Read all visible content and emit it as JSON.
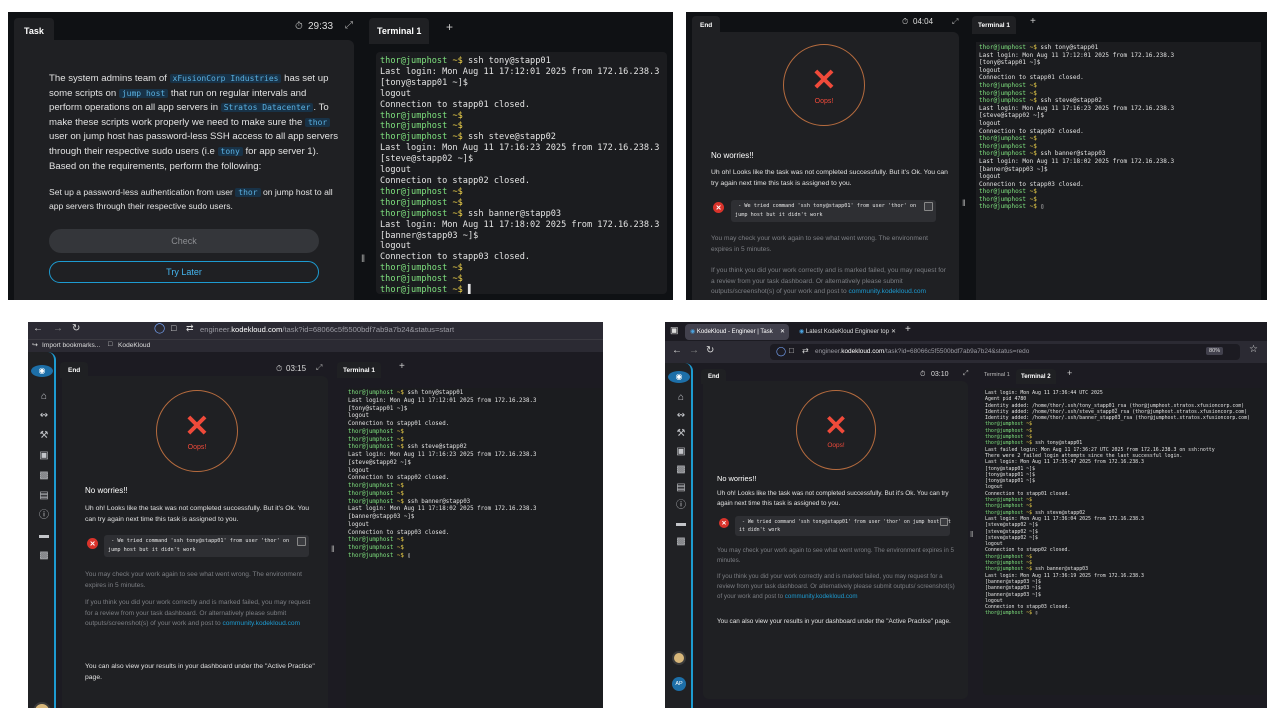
{
  "shot1": {
    "task_tab": "Task",
    "timer": "29:33",
    "term_tab": "Terminal 1",
    "add_tab": "+",
    "paragraph": {
      "p1": "The system admins team of",
      "company": "xFusionCorp Industries",
      "p2": "has set up some scripts on",
      "jumphost": "jump host",
      "p3": "that run on regular intervals and perform operations on all app servers in",
      "dc": "Stratos Datacenter",
      "p4": ". To make these scripts work properly we need to make sure the",
      "thor": "thor",
      "p5": "user on jump host has password-less SSH access to all app servers through their respective sudo users (i.e",
      "tony": "tony",
      "p6": "for app server 1). Based on the requirements, perform the following:"
    },
    "instruction": {
      "p1": "Set up a password-less authentication from user",
      "thor": "thor",
      "p2": "on jump host to all app servers through their respective sudo users."
    },
    "check_label": "Check",
    "try_later_label": "Try Later",
    "terminal": [
      {
        "p": "thor@jumphost",
        "s": " ~$",
        "t": " ssh tony@stapp01"
      },
      {
        "t": "Last login: Mon Aug 11 17:12:01 2025 from 172.16.238.3"
      },
      {
        "t": "[tony@stapp01 ~]$"
      },
      {
        "t": "logout"
      },
      {
        "t": "Connection to stapp01 closed."
      },
      {
        "p": "thor@jumphost",
        "s": " ~$",
        "t": ""
      },
      {
        "p": "thor@jumphost",
        "s": " ~$",
        "t": ""
      },
      {
        "p": "thor@jumphost",
        "s": " ~$",
        "t": " ssh steve@stapp02"
      },
      {
        "t": "Last login: Mon Aug 11 17:16:23 2025 from 172.16.238.3"
      },
      {
        "t": "[steve@stapp02 ~]$"
      },
      {
        "t": "logout"
      },
      {
        "t": "Connection to stapp02 closed."
      },
      {
        "p": "thor@jumphost",
        "s": " ~$",
        "t": ""
      },
      {
        "p": "thor@jumphost",
        "s": " ~$",
        "t": ""
      },
      {
        "p": "thor@jumphost",
        "s": " ~$",
        "t": " ssh banner@stapp03"
      },
      {
        "t": "Last login: Mon Aug 11 17:18:02 2025 from 172.16.238.3"
      },
      {
        "t": "[banner@stapp03 ~]$"
      },
      {
        "t": "logout"
      },
      {
        "t": "Connection to stapp03 closed."
      },
      {
        "p": "thor@jumphost",
        "s": " ~$",
        "t": ""
      },
      {
        "p": "thor@jumphost",
        "s": " ~$",
        "t": ""
      },
      {
        "p": "thor@jumphost",
        "s": " ~$",
        "t": " ▌"
      }
    ]
  },
  "shot2": {
    "end_tab": "End",
    "timer": "04:04",
    "term_tab": "Terminal 1",
    "add_tab": "+",
    "oops": "Oops!",
    "no_worries": "No worries!!",
    "msg": "Uh oh! Looks like the task was not completed successfully. But it's Ok. You can try again next time this task is assigned to you.",
    "err": " - We tried command 'ssh tony@stapp01' from user 'thor' on\njump host but it didn't work",
    "check_again": "You may check your work again to see what went wrong. The environment expires in 5 minutes.",
    "review": "If you think you did your work correctly and is marked failed, you may request for a review from your task dashboard. Or alternatively please submit outputs/screenshot(s) of your work and post to",
    "community": "community.kodekloud.com",
    "terminal": [
      {
        "p": "thor@jumphost",
        "s": " ~$",
        "t": " ssh tony@stapp01"
      },
      {
        "t": "Last login: Mon Aug 11 17:12:01 2025 from 172.16.238.3"
      },
      {
        "t": "[tony@stapp01 ~]$"
      },
      {
        "t": "logout"
      },
      {
        "t": "Connection to stapp01 closed."
      },
      {
        "p": "thor@jumphost",
        "s": " ~$",
        "t": ""
      },
      {
        "p": "thor@jumphost",
        "s": " ~$",
        "t": ""
      },
      {
        "p": "thor@jumphost",
        "s": " ~$",
        "t": " ssh steve@stapp02"
      },
      {
        "t": "Last login: Mon Aug 11 17:16:23 2025 from 172.16.238.3"
      },
      {
        "t": "[steve@stapp02 ~]$"
      },
      {
        "t": "logout"
      },
      {
        "t": "Connection to stapp02 closed."
      },
      {
        "p": "thor@jumphost",
        "s": " ~$",
        "t": ""
      },
      {
        "p": "thor@jumphost",
        "s": " ~$",
        "t": ""
      },
      {
        "p": "thor@jumphost",
        "s": " ~$",
        "t": " ssh banner@stapp03"
      },
      {
        "t": "Last login: Mon Aug 11 17:18:02 2025 from 172.16.238.3"
      },
      {
        "t": "[banner@stapp03 ~]$"
      },
      {
        "t": "logout"
      },
      {
        "t": "Connection to stapp03 closed."
      },
      {
        "p": "thor@jumphost",
        "s": " ~$",
        "t": ""
      },
      {
        "p": "thor@jumphost",
        "s": " ~$",
        "t": ""
      },
      {
        "p": "thor@jumphost",
        "s": " ~$",
        "t": " ▯"
      }
    ]
  },
  "shot3": {
    "url_domain": "engineer.",
    "url_bold": "kodekloud.com",
    "url_path": "/task?id=68066c5f5500bdf7ab9a7b24&status=start",
    "bookmark1": "Import bookmarks...",
    "bookmark2": "KodeKloud",
    "end_tab": "End",
    "timer": "03:15",
    "term_tab": "Terminal 1",
    "add_tab": "+",
    "oops": "Oops!",
    "no_worries": "No worries!!",
    "msg": "Uh oh! Looks like the task was not completed successfully. But it's Ok. You can try again next time this task is assigned to you.",
    "err": " - We tried command 'ssh tony@stapp01' from user 'thor' on\njump host but it didn't work",
    "check_again": "You may check your work again to see what went wrong. The environment expires in 5 minutes.",
    "review": "If you think you did your work correctly and is marked failed, you may request for a review from your task dashboard. Or alternatively please submit outputs/screenshot(s) of your work and post to",
    "community": "community.kodekloud.com",
    "view_results": "You can also view your results in your dashboard under the \"Active Practice\" page.",
    "terminal": [
      {
        "p": "thor@jumphost",
        "s": " ~$",
        "t": " ssh tony@stapp01"
      },
      {
        "t": "Last login: Mon Aug 11 17:12:01 2025 from 172.16.238.3"
      },
      {
        "t": "[tony@stapp01 ~]$"
      },
      {
        "t": "logout"
      },
      {
        "t": "Connection to stapp01 closed."
      },
      {
        "p": "thor@jumphost",
        "s": " ~$",
        "t": ""
      },
      {
        "p": "thor@jumphost",
        "s": " ~$",
        "t": ""
      },
      {
        "p": "thor@jumphost",
        "s": " ~$",
        "t": " ssh steve@stapp02"
      },
      {
        "t": "Last login: Mon Aug 11 17:16:23 2025 from 172.16.238.3"
      },
      {
        "t": "[steve@stapp02 ~]$"
      },
      {
        "t": "logout"
      },
      {
        "t": "Connection to stapp02 closed."
      },
      {
        "p": "thor@jumphost",
        "s": " ~$",
        "t": ""
      },
      {
        "p": "thor@jumphost",
        "s": " ~$",
        "t": ""
      },
      {
        "p": "thor@jumphost",
        "s": " ~$",
        "t": " ssh banner@stapp03"
      },
      {
        "t": "Last login: Mon Aug 11 17:18:02 2025 from 172.16.238.3"
      },
      {
        "t": "[banner@stapp03 ~]$"
      },
      {
        "t": "logout"
      },
      {
        "t": "Connection to stapp03 closed."
      },
      {
        "p": "thor@jumphost",
        "s": " ~$",
        "t": ""
      },
      {
        "p": "thor@jumphost",
        "s": " ~$",
        "t": ""
      },
      {
        "p": "thor@jumphost",
        "s": " ~$",
        "t": " ▯"
      }
    ]
  },
  "shot4": {
    "browser_tab1": "KodeKloud - Engineer | Task",
    "browser_tab2": "Latest KodeKloud Engineer top",
    "url_domain": "engineer.",
    "url_bold": "kodekloud.com",
    "url_path": "/task?id=68066c5f5500bdf7ab9a7b24&status=redo",
    "zoom": "80%",
    "end_tab": "End",
    "timer": "03:10",
    "term_tab1": "Terminal 1",
    "term_tab2": "Terminal 2",
    "add_tab": "+",
    "oops": "Oops!",
    "no_worries": "No worries!!",
    "msg": "Uh oh! Looks like the task was not completed successfully. But it's Ok. You can try again next time this task is assigned to you.",
    "err": " - We tried command 'ssh tony@stapp01' from user 'thor' on jump host but\nit didn't work",
    "check_again": "You may check your work again to see what went wrong. The environment expires in 5 minutes.",
    "review": "If you think you did your work correctly and is marked failed, you may request for a review from your task dashboard. Or alternatively please submit outputs/ screenshot(s) of your work and post to",
    "community": "community.kodekloud.com",
    "view_results": "You can also view your results in your dashboard under the \"Active Practice\" page.",
    "avatar": "AP",
    "terminal": [
      {
        "t": "Last login: Mon Aug 11 17:36:44 UTC 2025"
      },
      {
        "t": "Agent pid 4780"
      },
      {
        "t": "Identity added: /home/thor/.ssh/tony_stapp01_rsa (thor@jumphost.stratos.xfusioncorp.com)"
      },
      {
        "t": "Identity added: /home/thor/.ssh/steve_stapp02_rsa (thor@jumphost.stratos.xfusioncorp.com)"
      },
      {
        "t": "Identity added: /home/thor/.ssh/banner_stapp03_rsa (thor@jumphost.stratos.xfusioncorp.com)"
      },
      {
        "p": "thor@jumphost",
        "s": " ~$",
        "t": ""
      },
      {
        "p": "thor@jumphost",
        "s": " ~$",
        "t": ""
      },
      {
        "p": "thor@jumphost",
        "s": " ~$",
        "t": ""
      },
      {
        "p": "thor@jumphost",
        "s": " ~$",
        "t": " ssh tony@stapp01"
      },
      {
        "t": "Last failed login: Mon Aug 11 17:36:27 UTC 2025 from 172.16.238.3 on ssh:notty"
      },
      {
        "t": "There were 2 failed login attempts since the last successful login."
      },
      {
        "t": "Last login: Mon Aug 11 17:35:47 2025 from 172.16.238.3"
      },
      {
        "t": "[tony@stapp01 ~]$"
      },
      {
        "t": "[tony@stapp01 ~]$"
      },
      {
        "t": "[tony@stapp01 ~]$"
      },
      {
        "t": "logout"
      },
      {
        "t": "Connection to stapp01 closed."
      },
      {
        "p": "thor@jumphost",
        "s": " ~$",
        "t": ""
      },
      {
        "p": "thor@jumphost",
        "s": " ~$",
        "t": ""
      },
      {
        "p": "thor@jumphost",
        "s": " ~$",
        "t": " ssh steve@stapp02"
      },
      {
        "t": "Last login: Mon Aug 11 17:36:04 2025 from 172.16.238.3"
      },
      {
        "t": "[steve@stapp02 ~]$"
      },
      {
        "t": "[steve@stapp02 ~]$"
      },
      {
        "t": "[steve@stapp02 ~]$"
      },
      {
        "t": "logout"
      },
      {
        "t": "Connection to stapp02 closed."
      },
      {
        "p": "thor@jumphost",
        "s": " ~$",
        "t": ""
      },
      {
        "p": "thor@jumphost",
        "s": " ~$",
        "t": ""
      },
      {
        "p": "thor@jumphost",
        "s": " ~$",
        "t": " ssh banner@stapp03"
      },
      {
        "t": "Last login: Mon Aug 11 17:36:19 2025 from 172.16.238.3"
      },
      {
        "t": "[banner@stapp03 ~]$"
      },
      {
        "t": "[banner@stapp03 ~]$"
      },
      {
        "t": "[banner@stapp03 ~]$"
      },
      {
        "t": "logout"
      },
      {
        "t": "Connection to stapp03 closed."
      },
      {
        "p": "thor@jumphost",
        "s": " ~$",
        "t": " ▯"
      }
    ]
  }
}
